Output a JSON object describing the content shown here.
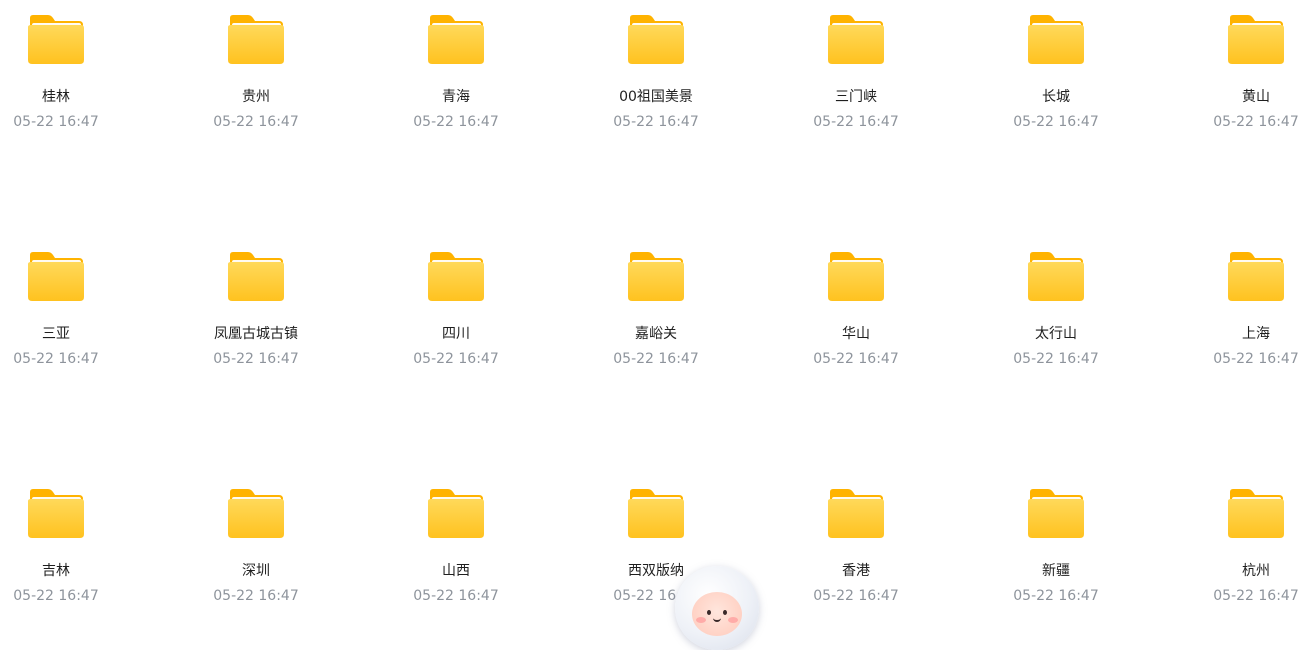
{
  "folders": [
    {
      "name": "桂林",
      "date": "05-22 16:47"
    },
    {
      "name": "贵州",
      "date": "05-22 16:47"
    },
    {
      "name": "青海",
      "date": "05-22 16:47"
    },
    {
      "name": "00祖国美景",
      "date": "05-22 16:47"
    },
    {
      "name": "三门峡",
      "date": "05-22 16:47"
    },
    {
      "name": "长城",
      "date": "05-22 16:47"
    },
    {
      "name": "黄山",
      "date": "05-22 16:47"
    },
    {
      "name": "三亚",
      "date": "05-22 16:47"
    },
    {
      "name": "凤凰古城古镇",
      "date": "05-22 16:47"
    },
    {
      "name": "四川",
      "date": "05-22 16:47"
    },
    {
      "name": "嘉峪关",
      "date": "05-22 16:47"
    },
    {
      "name": "华山",
      "date": "05-22 16:47"
    },
    {
      "name": "太行山",
      "date": "05-22 16:47"
    },
    {
      "name": "上海",
      "date": "05-22 16:47"
    },
    {
      "name": "吉林",
      "date": "05-22 16:47"
    },
    {
      "name": "深圳",
      "date": "05-22 16:47"
    },
    {
      "name": "山西",
      "date": "05-22 16:47"
    },
    {
      "name": "西双版纳",
      "date": "05-22 16:47"
    },
    {
      "name": "香港",
      "date": "05-22 16:47"
    },
    {
      "name": "新疆",
      "date": "05-22 16:47"
    },
    {
      "name": "杭州",
      "date": "05-22 16:47"
    }
  ],
  "icons": {
    "folder": "folder-icon",
    "mascot": "mascot-avatar"
  },
  "colors": {
    "folder_body": "#ffcc33",
    "folder_tab": "#ffb300",
    "name_text": "#1f1f1f",
    "date_text": "#8e949c"
  }
}
